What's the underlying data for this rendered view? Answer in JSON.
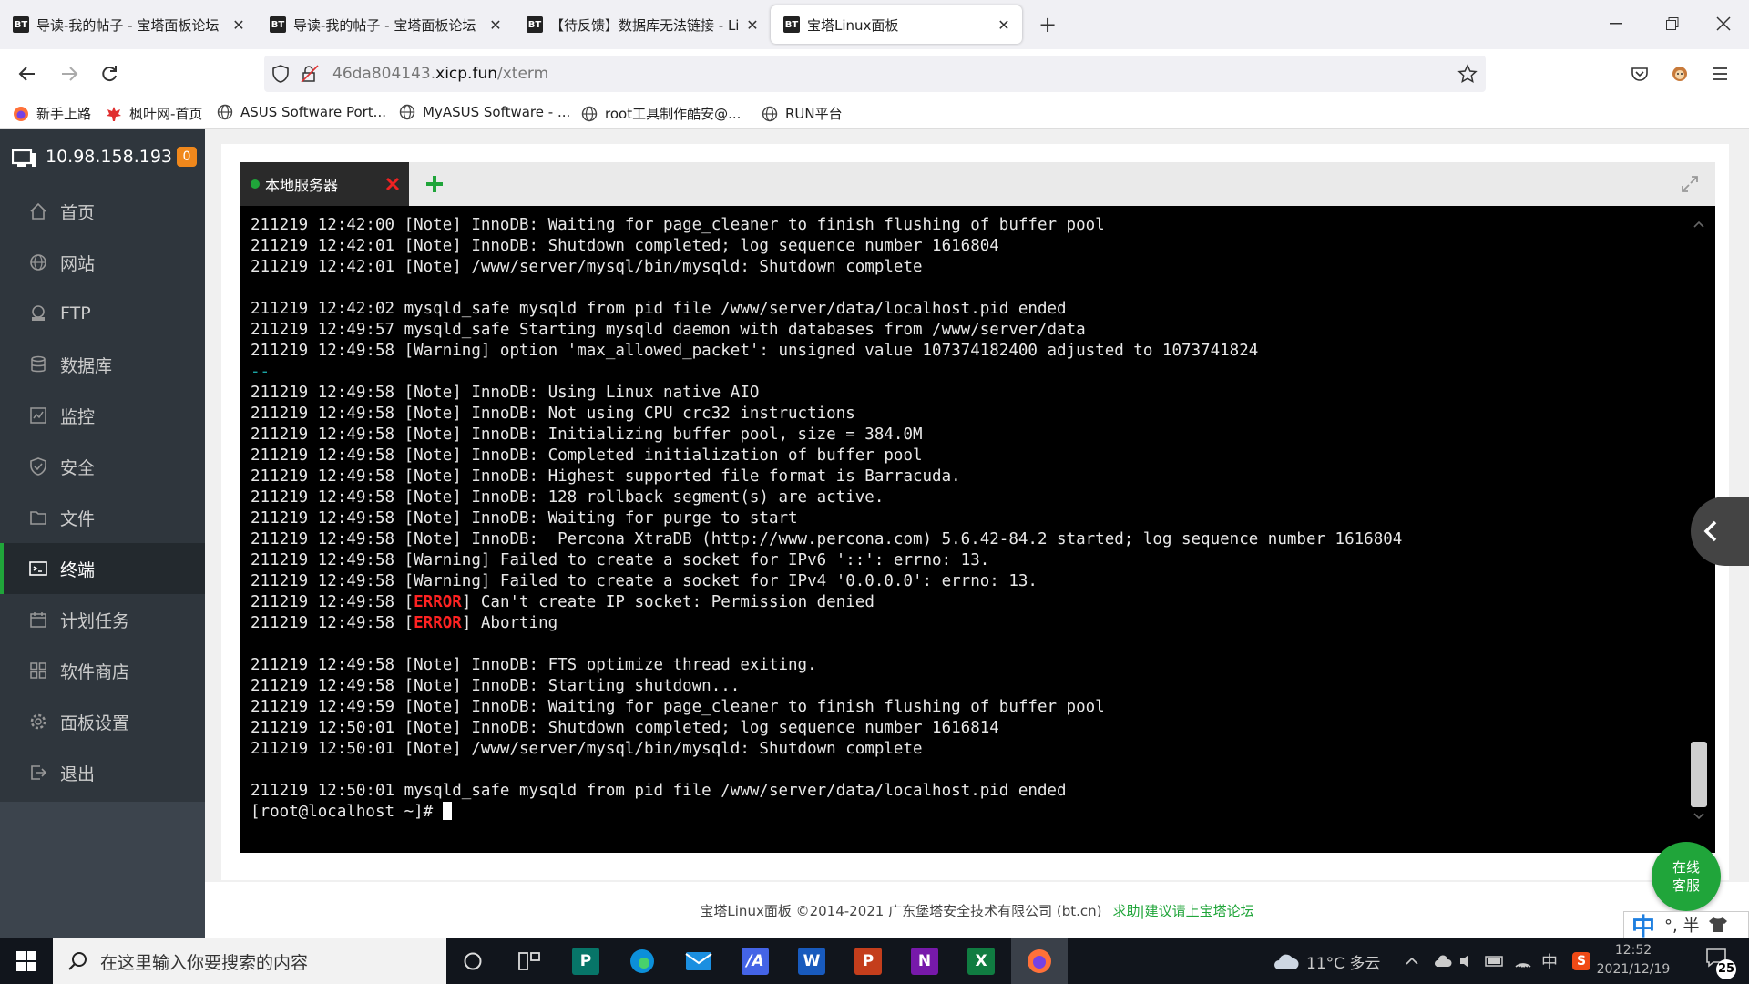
{
  "browser": {
    "tabs": [
      {
        "favicon": "BT",
        "title": "导读-我的帖子 - 宝塔面板论坛"
      },
      {
        "favicon": "BT",
        "title": "导读-我的帖子 - 宝塔面板论坛"
      },
      {
        "favicon": "BT",
        "title": "【待反馈】数据库无法链接 - Li"
      },
      {
        "favicon": "BT",
        "title": "宝塔Linux面板"
      }
    ],
    "url_host": "46da804143.",
    "url_domain": "xicp.fun",
    "url_path": "/xterm",
    "bookmarks": [
      "新手上路",
      "枫叶网-首页",
      "ASUS Software Port...",
      "MyASUS Software - ...",
      "root工具制作酷安@...",
      "RUN平台"
    ]
  },
  "sidebar": {
    "ip": "10.98.158.193",
    "badge": "0",
    "items": [
      {
        "label": "首页",
        "icon": "home-icon"
      },
      {
        "label": "网站",
        "icon": "globe-icon"
      },
      {
        "label": "FTP",
        "icon": "ftp-icon"
      },
      {
        "label": "数据库",
        "icon": "database-icon"
      },
      {
        "label": "监控",
        "icon": "monitor-icon"
      },
      {
        "label": "安全",
        "icon": "shield-icon"
      },
      {
        "label": "文件",
        "icon": "folder-icon"
      },
      {
        "label": "终端",
        "icon": "terminal-icon"
      },
      {
        "label": "计划任务",
        "icon": "calendar-icon"
      },
      {
        "label": "软件商店",
        "icon": "apps-icon"
      },
      {
        "label": "面板设置",
        "icon": "gear-icon"
      },
      {
        "label": "退出",
        "icon": "logout-icon"
      }
    ],
    "active": "终端"
  },
  "terminal": {
    "tab_label": "本地服务器",
    "lines": [
      "211219 12:42:00 [Note] InnoDB: Waiting for page_cleaner to finish flushing of buffer pool",
      "211219 12:42:01 [Note] InnoDB: Shutdown completed; log sequence number 1616804",
      "211219 12:42:01 [Note] /www/server/mysql/bin/mysqld: Shutdown complete",
      "",
      "211219 12:42:02 mysqld_safe mysqld from pid file /www/server/data/localhost.pid ended",
      "211219 12:49:57 mysqld_safe Starting mysqld daemon with databases from /www/server/data",
      "211219 12:49:58 [Warning] option 'max_allowed_packet': unsigned value 107374182400 adjusted to 1073741824",
      "--",
      "211219 12:49:58 [Note] InnoDB: Using Linux native AIO",
      "211219 12:49:58 [Note] InnoDB: Not using CPU crc32 instructions",
      "211219 12:49:58 [Note] InnoDB: Initializing buffer pool, size = 384.0M",
      "211219 12:49:58 [Note] InnoDB: Completed initialization of buffer pool",
      "211219 12:49:58 [Note] InnoDB: Highest supported file format is Barracuda.",
      "211219 12:49:58 [Note] InnoDB: 128 rollback segment(s) are active.",
      "211219 12:49:58 [Note] InnoDB: Waiting for purge to start",
      "211219 12:49:58 [Note] InnoDB:  Percona XtraDB (http://www.percona.com) 5.6.42-84.2 started; log sequence number 1616804",
      "211219 12:49:58 [Warning] Failed to create a socket for IPv6 '::': errno: 13.",
      "211219 12:49:58 [Warning] Failed to create a socket for IPv4 '0.0.0.0': errno: 13.",
      "211219 12:49:58 [ERROR] Can't create IP socket: Permission denied",
      "211219 12:49:58 [ERROR] Aborting",
      "",
      "211219 12:49:58 [Note] InnoDB: FTS optimize thread exiting.",
      "211219 12:49:58 [Note] InnoDB: Starting shutdown...",
      "211219 12:49:59 [Note] InnoDB: Waiting for page_cleaner to finish flushing of buffer pool",
      "211219 12:50:01 [Note] InnoDB: Shutdown completed; log sequence number 1616814",
      "211219 12:50:01 [Note] /www/server/mysql/bin/mysqld: Shutdown complete",
      "",
      "211219 12:50:01 mysqld_safe mysqld from pid file /www/server/data/localhost.pid ended"
    ],
    "prompt": "[root@localhost ~]# "
  },
  "footer": {
    "copyright": "宝塔Linux面板 ©2014-2021 广东堡塔安全技术有限公司 (bt.cn)",
    "link": "求助|建议请上宝塔论坛"
  },
  "kefu": {
    "line1": "在线",
    "line2": "客服"
  },
  "ime": {
    "lang": "中",
    "rest": "°, 半"
  },
  "taskbar": {
    "search_placeholder": "在这里输入你要搜索的内容",
    "weather": "11°C 多云",
    "ime_lang": "中",
    "time": "12:52",
    "date": "2021/12/19",
    "notifications": "25"
  },
  "colors": {
    "accent": "#20a53a",
    "error": "#ff2222",
    "badge": "#f0881c"
  }
}
